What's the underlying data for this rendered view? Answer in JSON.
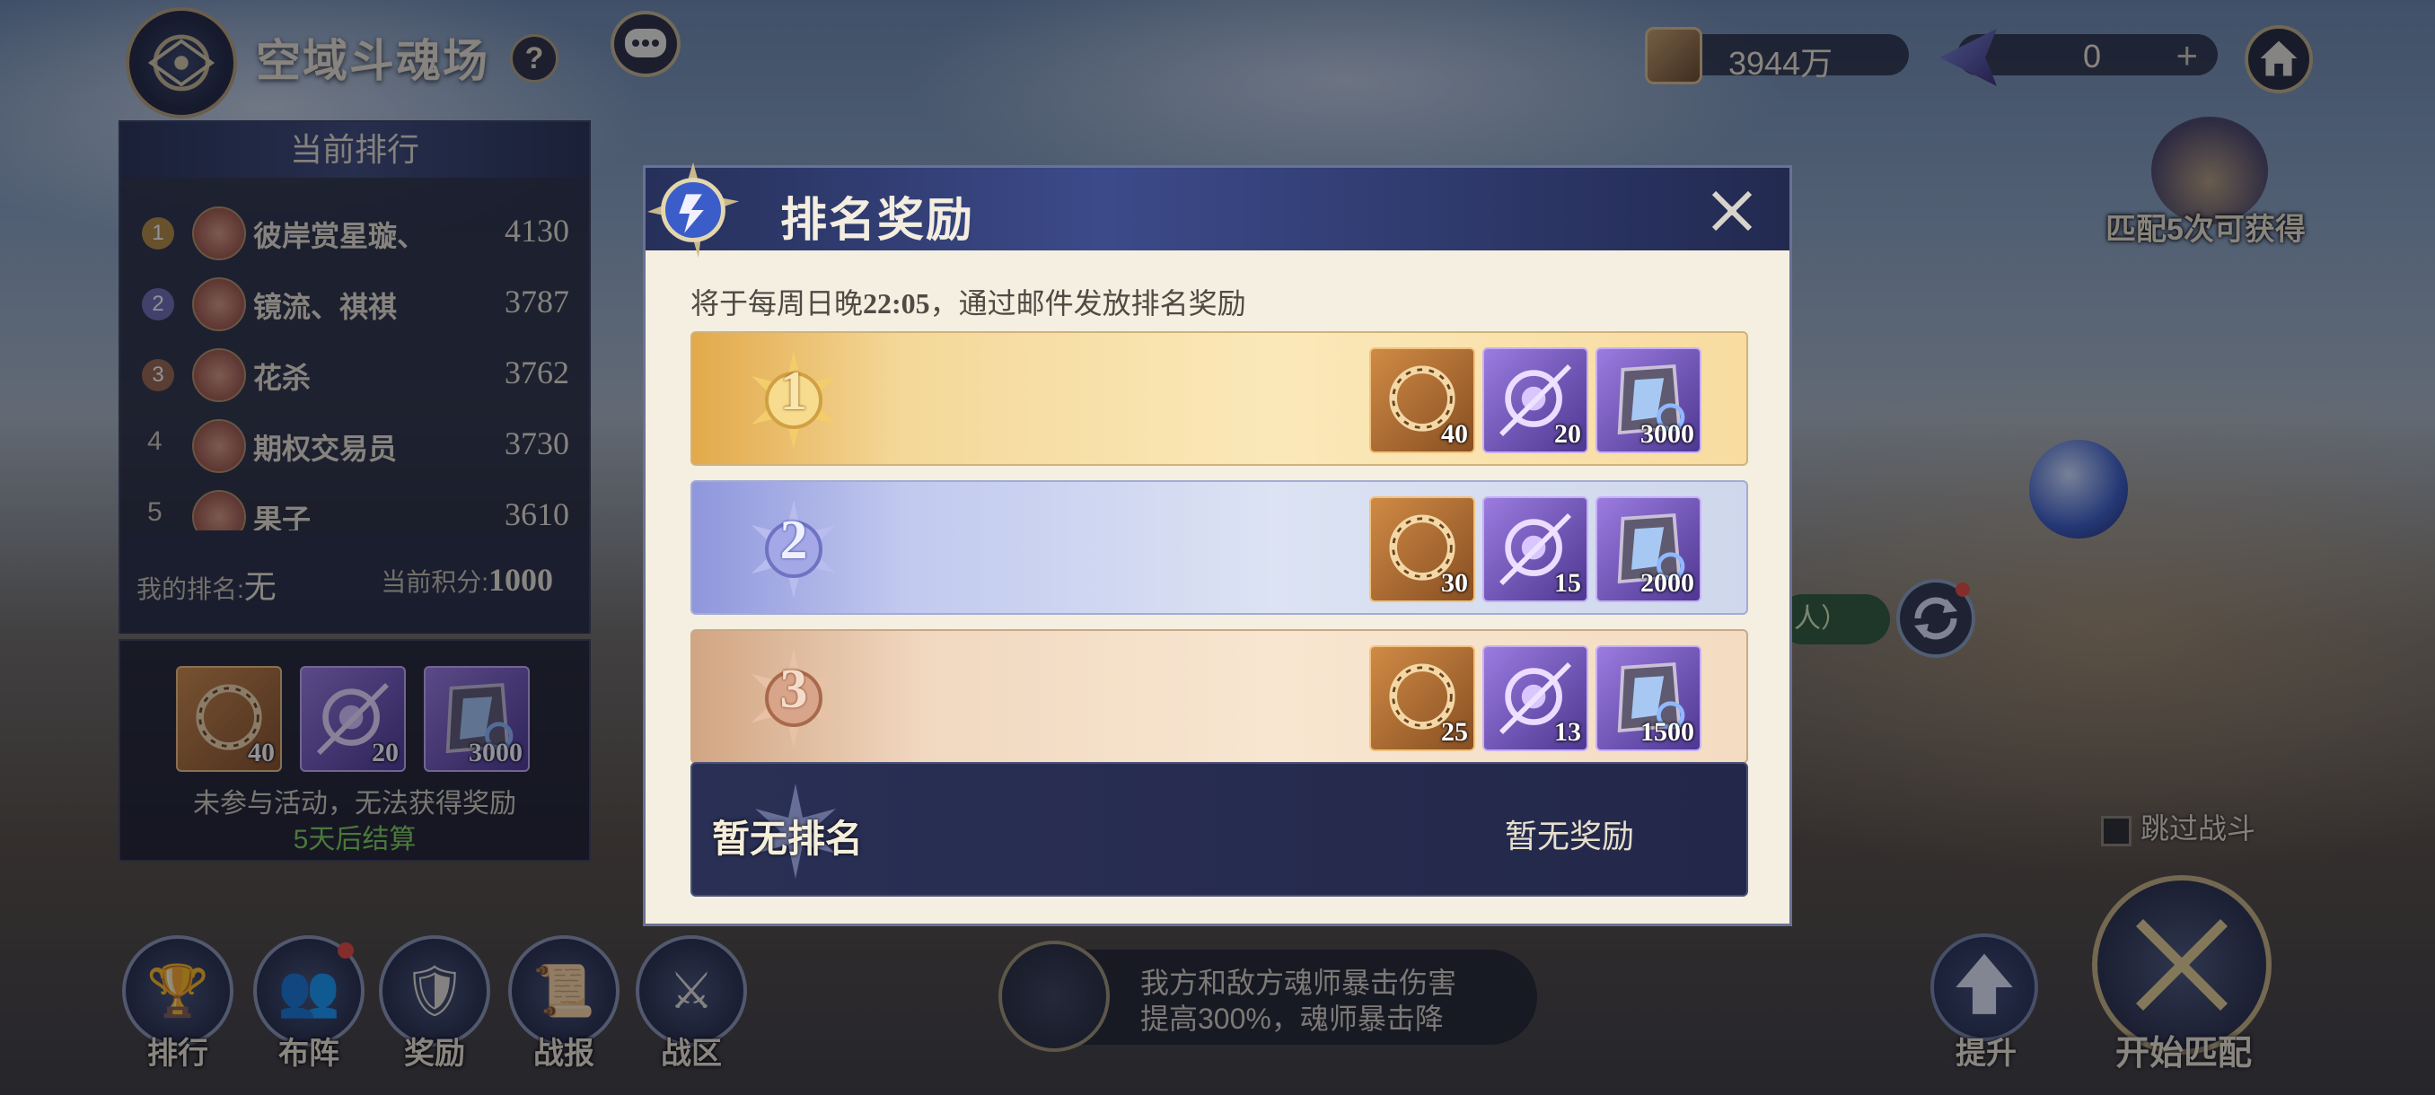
{
  "header": {
    "title": "空域斗魂场",
    "help": "?",
    "currency1": "3944万",
    "currency2": "0",
    "currency2_plus": "+"
  },
  "leaderboard": {
    "title": "当前排行",
    "rows": [
      {
        "rank": "1",
        "name": "彼岸赏星璇、",
        "score": "4130"
      },
      {
        "rank": "2",
        "name": "镜流、祺祺",
        "score": "3787"
      },
      {
        "rank": "3",
        "name": "花杀",
        "score": "3762"
      },
      {
        "rank": "4",
        "name": "期权交易员",
        "score": "3730"
      },
      {
        "rank": "5",
        "name": "果子",
        "score": "3610"
      }
    ],
    "my_rank_label": "我的排名:",
    "my_rank_value": "无",
    "my_score_label": "当前积分:",
    "my_score_value": "1000"
  },
  "side_reward": {
    "items": [
      {
        "icon": "ring-token-icon",
        "qty": "40"
      },
      {
        "icon": "soul-orb-icon",
        "qty": "20"
      },
      {
        "icon": "crystal-chest-icon",
        "qty": "3000"
      }
    ],
    "message": "未参与活动，无法获得奖励",
    "settle": "5天后结算"
  },
  "right": {
    "match_tip": "匹配5次可获得",
    "pill_text": "人）",
    "skip_label": "跳过战斗",
    "upgrade_label": "提升",
    "start_label": "开始匹配"
  },
  "bottom_nav": [
    {
      "label": "排行",
      "icon": "trophy-icon"
    },
    {
      "label": "布阵",
      "icon": "formation-icon"
    },
    {
      "label": "奖励",
      "icon": "reward-icon"
    },
    {
      "label": "战报",
      "icon": "battle-report-icon"
    },
    {
      "label": "战区",
      "icon": "war-zone-icon"
    }
  ],
  "buff": {
    "line1": "我方和敌方魂师暴击伤害",
    "line2": "提高300%，魂师暴击降"
  },
  "modal": {
    "title": "排名奖励",
    "notice_pre": "将于每周日晚",
    "notice_time": "22:05",
    "notice_post": "，通过邮件发放排名奖励",
    "tiers": [
      {
        "rank": "1",
        "rewards": [
          {
            "icon": "ring-token-icon",
            "qty": "40"
          },
          {
            "icon": "soul-orb-icon",
            "qty": "20"
          },
          {
            "icon": "crystal-chest-icon",
            "qty": "3000"
          }
        ]
      },
      {
        "rank": "2",
        "rewards": [
          {
            "icon": "ring-token-icon",
            "qty": "30"
          },
          {
            "icon": "soul-orb-icon",
            "qty": "15"
          },
          {
            "icon": "crystal-chest-icon",
            "qty": "2000"
          }
        ]
      },
      {
        "rank": "3",
        "rewards": [
          {
            "icon": "ring-token-icon",
            "qty": "25"
          },
          {
            "icon": "soul-orb-icon",
            "qty": "13"
          },
          {
            "icon": "crystal-chest-icon",
            "qty": "1500"
          }
        ]
      }
    ],
    "my_rank": "暂无排名",
    "my_reward": "暂无奖励"
  },
  "colors": {
    "gold": "#e2a94a",
    "silver": "#8f96dc",
    "bronze": "#d1a583",
    "panel_navy": "#2a3055",
    "settle_green": "#7fcf57"
  }
}
